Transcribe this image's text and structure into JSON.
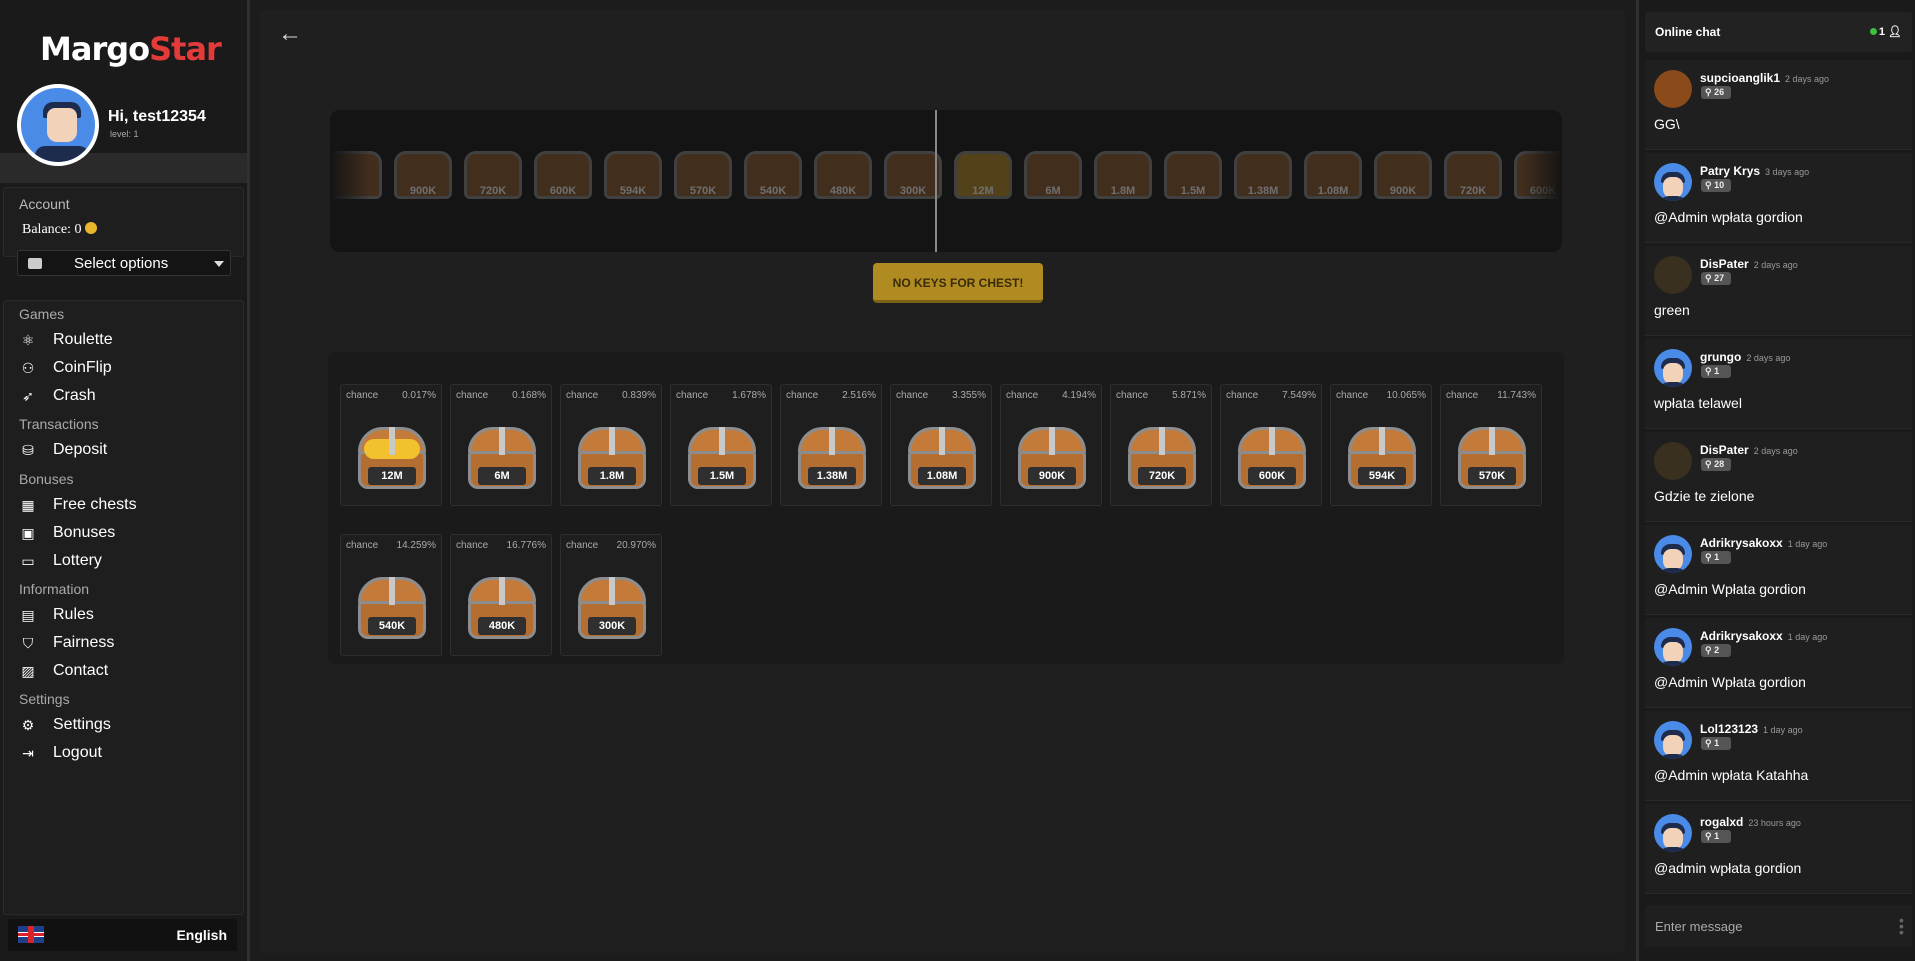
{
  "brand": {
    "part1": "Margo",
    "part2": "Star"
  },
  "profile": {
    "greeting": "Hi, test12354",
    "level": "level: 1"
  },
  "account": {
    "label": "Account",
    "balance_label": "Balance: 0",
    "select_label": "Select options"
  },
  "nav": {
    "games": "Games",
    "roulette": "Roulette",
    "coinflip": "CoinFlip",
    "crash": "Crash",
    "transactions": "Transactions",
    "deposit": "Deposit",
    "bonuses_cat": "Bonuses",
    "free_chests": "Free chests",
    "bonuses": "Bonuses",
    "lottery": "Lottery",
    "information": "Information",
    "rules": "Rules",
    "fairness": "Fairness",
    "contact": "Contact",
    "settings_cat": "Settings",
    "settings": "Settings",
    "logout": "Logout"
  },
  "language": {
    "name": "English"
  },
  "reel": {
    "items": [
      "",
      "900K",
      "720K",
      "600K",
      "594K",
      "570K",
      "540K",
      "480K",
      "300K",
      "12M",
      "6M",
      "1.8M",
      "1.5M",
      "1.38M",
      "1.08M",
      "900K",
      "720K",
      "600K",
      ""
    ]
  },
  "action": {
    "no_keys": "NO KEYS FOR CHEST!"
  },
  "prizes": {
    "chance_label": "chance",
    "items": [
      {
        "value": "12M",
        "chance": "0.017%"
      },
      {
        "value": "6M",
        "chance": "0.168%"
      },
      {
        "value": "1.8M",
        "chance": "0.839%"
      },
      {
        "value": "1.5M",
        "chance": "1.678%"
      },
      {
        "value": "1.38M",
        "chance": "2.516%"
      },
      {
        "value": "1.08M",
        "chance": "3.355%"
      },
      {
        "value": "900K",
        "chance": "4.194%"
      },
      {
        "value": "720K",
        "chance": "5.871%"
      },
      {
        "value": "600K",
        "chance": "7.549%"
      },
      {
        "value": "594K",
        "chance": "10.065%"
      },
      {
        "value": "570K",
        "chance": "11.743%"
      },
      {
        "value": "540K",
        "chance": "14.259%"
      },
      {
        "value": "480K",
        "chance": "16.776%"
      },
      {
        "value": "300K",
        "chance": "20.970%"
      }
    ]
  },
  "chat": {
    "title": "Online chat",
    "online_count": "1",
    "input_placeholder": "Enter message",
    "messages": [
      {
        "user": "supcioanglik1",
        "time": "2 days ago",
        "level": "26",
        "text": "GG\\"
      },
      {
        "user": "Patry Krys",
        "time": "3 days ago",
        "level": "10",
        "text": "@Admin wpłata gordion"
      },
      {
        "user": "DisPater",
        "time": "2 days ago",
        "level": "27",
        "text": "green"
      },
      {
        "user": "grungo",
        "time": "2 days ago",
        "level": "1",
        "text": "wpłata telawel"
      },
      {
        "user": "DisPater",
        "time": "2 days ago",
        "level": "28",
        "text": "Gdzie te zielone"
      },
      {
        "user": "Adrikrysakoxx",
        "time": "1 day ago",
        "level": "1",
        "text": "@Admin Wpłata gordion"
      },
      {
        "user": "Adrikrysakoxx",
        "time": "1 day ago",
        "level": "2",
        "text": "@Admin Wpłata gordion"
      },
      {
        "user": "Lol123123",
        "time": "1 day ago",
        "level": "1",
        "text": "@Admin wpłata Katahha"
      },
      {
        "user": "rogalxd",
        "time": "23 hours ago",
        "level": "1",
        "text": "@admin wpłata gordion"
      }
    ]
  },
  "colors": {
    "accent_red": "#e33a3a",
    "button_gold": "#b08b22",
    "online_green": "#3fbf3f",
    "avatar_blue": "#4a8be8"
  }
}
